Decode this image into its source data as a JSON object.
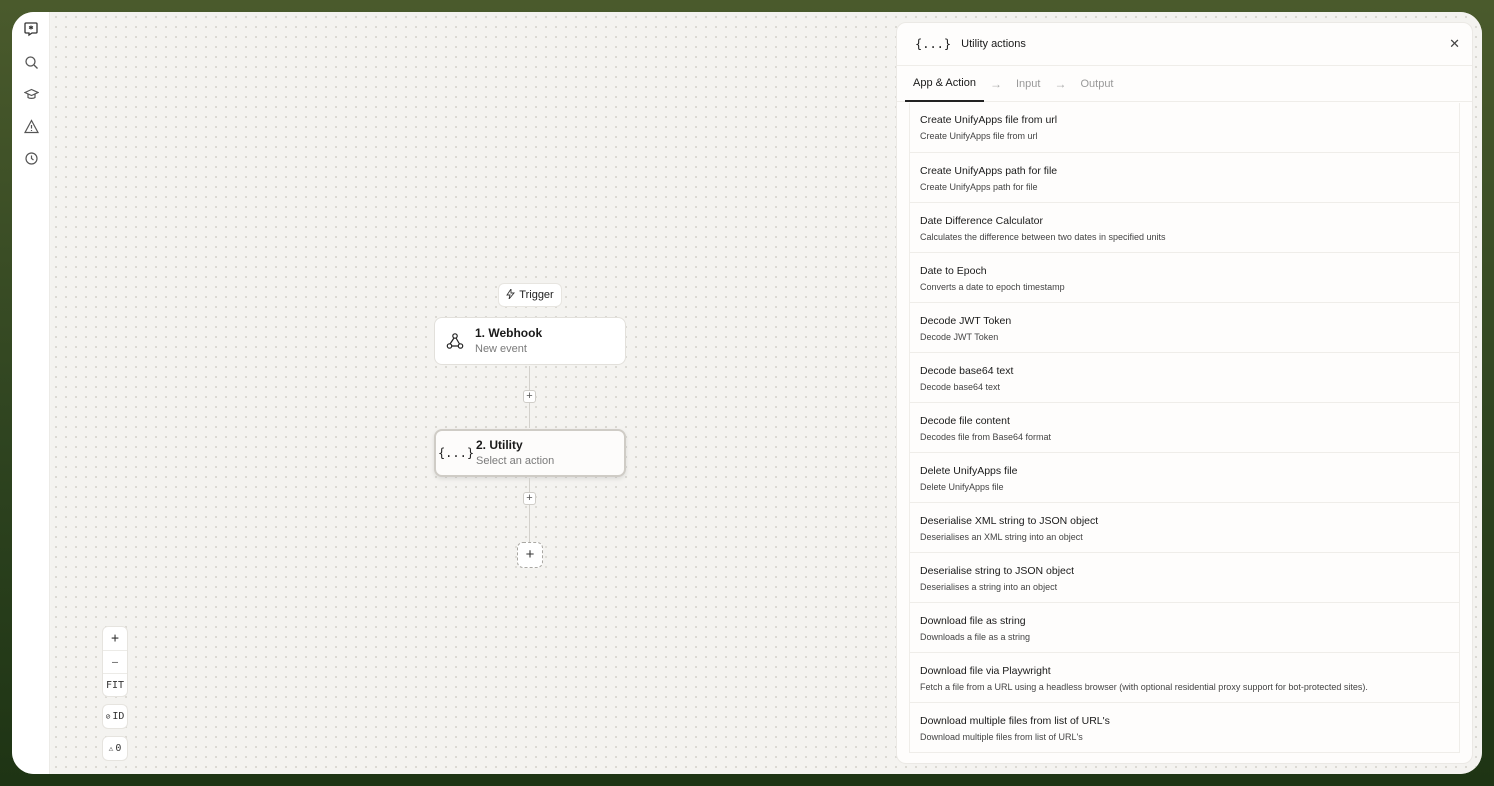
{
  "canvas": {
    "trigger_label": "Trigger",
    "nodes": [
      {
        "title": "1. Webhook",
        "subtitle": "New event"
      },
      {
        "title": "2. Utility",
        "subtitle": "Select an action",
        "icon_text": "{...}"
      }
    ],
    "add_step": "+",
    "zoom": {
      "plus": "+",
      "minus": "—",
      "fit": "FIT",
      "id": "ID",
      "warnings": "0"
    }
  },
  "panel": {
    "icon_text": "{...}",
    "title": "Utility actions",
    "close": "✕",
    "tabs": [
      {
        "label": "App & Action",
        "active": true
      },
      {
        "label": "Input",
        "active": false
      },
      {
        "label": "Output",
        "active": false
      }
    ],
    "actions": [
      {
        "title": "Create UnifyApps file from url",
        "desc": "Create UnifyApps file from url"
      },
      {
        "title": "Create UnifyApps path for file",
        "desc": "Create UnifyApps path for file"
      },
      {
        "title": "Date Difference Calculator",
        "desc": "Calculates the difference between two dates in specified units"
      },
      {
        "title": "Date to Epoch",
        "desc": "Converts a date to epoch timestamp"
      },
      {
        "title": "Decode JWT Token",
        "desc": "Decode JWT Token"
      },
      {
        "title": "Decode base64 text",
        "desc": "Decode base64 text"
      },
      {
        "title": "Decode file content",
        "desc": "Decodes file from Base64 format"
      },
      {
        "title": "Delete UnifyApps file",
        "desc": "Delete UnifyApps file"
      },
      {
        "title": "Deserialise XML string to JSON object",
        "desc": "Deserialises an XML string into an object"
      },
      {
        "title": "Deserialise string to JSON object",
        "desc": "Deserialises a string into an object"
      },
      {
        "title": "Download file as string",
        "desc": "Downloads a file as a string"
      },
      {
        "title": "Download file via Playwright",
        "desc": "Fetch a file from a URL using a headless browser (with optional residential proxy support for bot-protected sites)."
      },
      {
        "title": "Download multiple files from list of URL's",
        "desc": "Download multiple files from list of URL's"
      }
    ]
  }
}
